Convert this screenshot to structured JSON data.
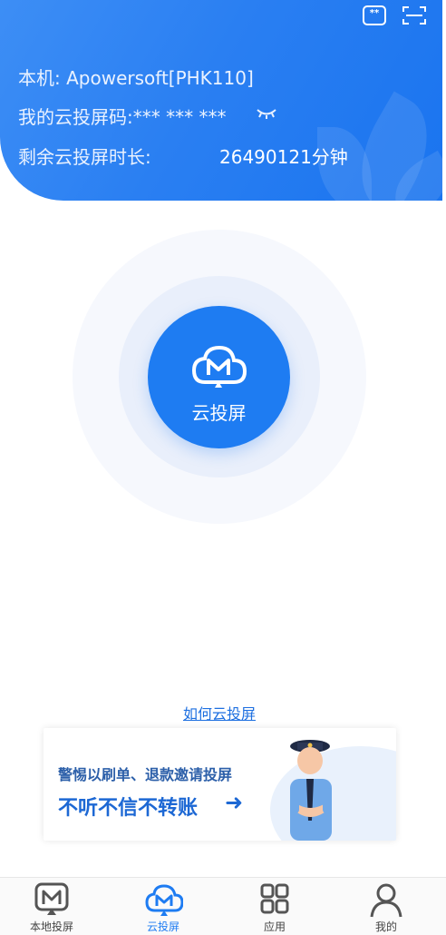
{
  "header": {
    "device_label": "本机: Apowersoft[PHK110]",
    "code_label": "我的云投屏码:*** *** ***",
    "remaining_label": "剩余云投屏时长:",
    "remaining_value": "26490121分钟",
    "icons": [
      "qr-code-icon",
      "scan-icon",
      "eye-closed-icon"
    ]
  },
  "main": {
    "cast_button_label": "云投屏",
    "howto_link": "如何云投屏"
  },
  "banner": {
    "line1": "警惕以刷单、退款邀请投屏",
    "line2": "不听不信不转账",
    "arrow": "➜"
  },
  "tabbar": {
    "tabs": [
      {
        "label": "本地投屏",
        "icon": "local-cast-icon"
      },
      {
        "label": "云投屏",
        "icon": "cloud-cast-icon"
      },
      {
        "label": "应用",
        "icon": "apps-grid-icon"
      },
      {
        "label": "我的",
        "icon": "profile-icon"
      }
    ],
    "active_index": 1
  },
  "colors": {
    "brand_blue": "#1e7cf2",
    "header_text": "#eaf2ff",
    "banner_blue": "#1d68d4"
  }
}
